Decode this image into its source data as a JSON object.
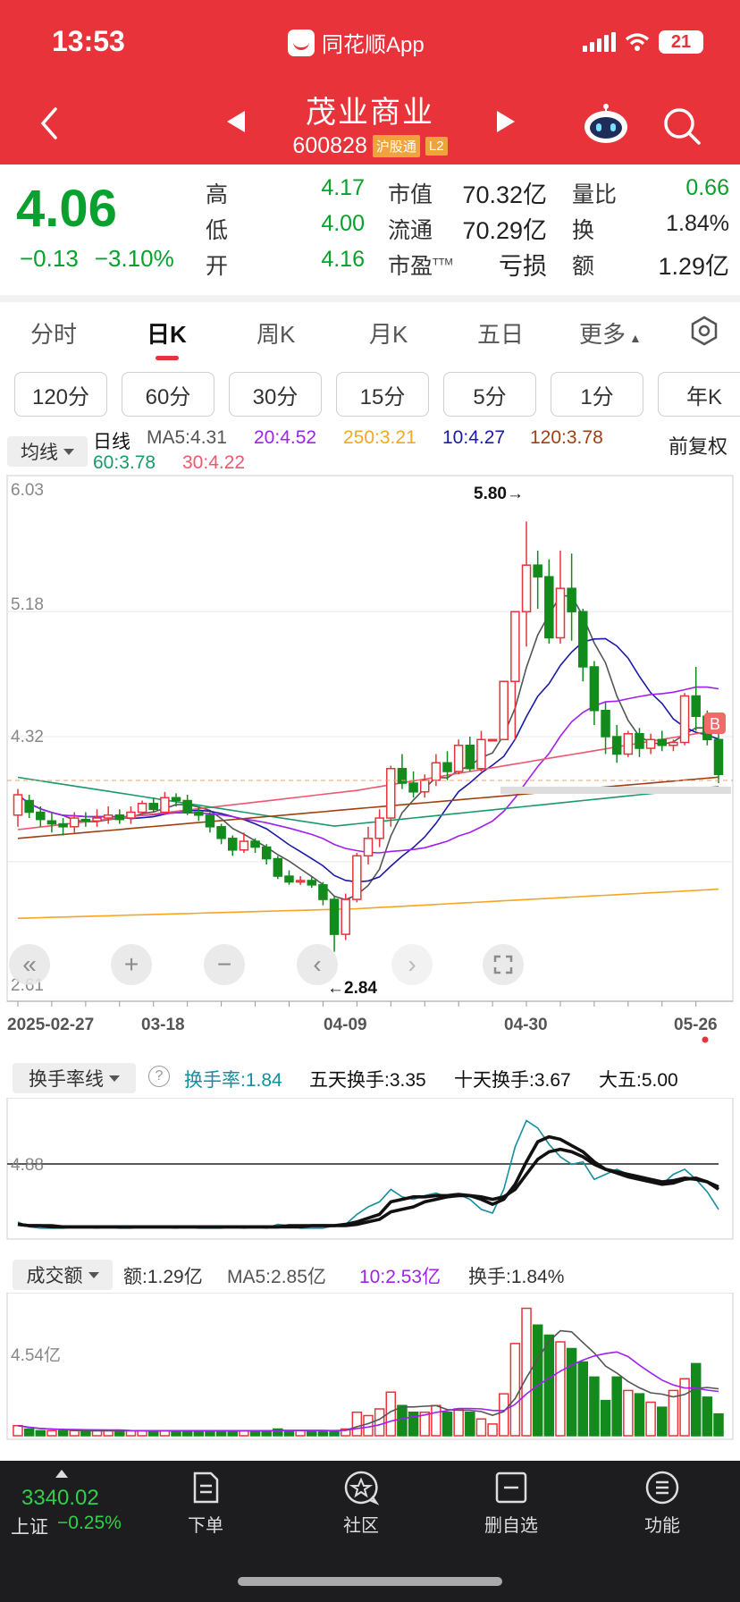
{
  "status_bar": {
    "time": "13:53",
    "app_label": "同花顺App",
    "battery": "21"
  },
  "header": {
    "stock_name": "茂业商业",
    "stock_code": "600828",
    "tag_hgt": "沪股通",
    "tag_level": "L2"
  },
  "quote": {
    "price": "4.06",
    "change": "−0.13",
    "change_pct": "−3.10%",
    "high_label": "高",
    "high": "4.17",
    "low_label": "低",
    "low": "4.00",
    "open_label": "开",
    "open": "4.16",
    "mktcap_label": "市值",
    "mktcap": "70.32亿",
    "float_label": "流通",
    "float": "70.29亿",
    "pe_label": "市盈",
    "pe_sup": "TTM",
    "pe": "亏损",
    "volratio_label": "量比",
    "volratio": "0.66",
    "turnover_label": "换",
    "turnover": "1.84%",
    "amount_label": "额",
    "amount": "1.29亿"
  },
  "tabs": [
    "分时",
    "日K",
    "周K",
    "月K",
    "五日",
    "更多"
  ],
  "periods": [
    "120分",
    "60分",
    "30分",
    "15分",
    "5分",
    "1分",
    "年K"
  ],
  "ma": {
    "selector": "均线",
    "line": "日线",
    "ma5": "MA5:4.31",
    "ma20": "20:4.52",
    "ma250": "250:3.21",
    "ma10": "10:4.27",
    "ma120": "120:3.78",
    "ma60": "60:3.78",
    "ma30": "30:4.22",
    "adjust": "前复权",
    "colors": {
      "ma5": "#555555",
      "ma10": "#1a1aa8",
      "ma20": "#a020f0",
      "ma30": "#f0566e",
      "ma60": "#1a9a6a",
      "ma120": "#a04010",
      "ma250": "#f5a623"
    }
  },
  "kline": {
    "y_labels": [
      "6.03",
      "5.18",
      "4.32",
      "2.61"
    ],
    "high_marker": "5.80→",
    "low_marker": "←2.84",
    "dates": [
      "2025-02-27",
      "03-18",
      "04-09",
      "04-30",
      "05-26"
    ],
    "b_marker": "B",
    "chart_data": {
      "type": "candlestick",
      "ylim": [
        2.61,
        6.03
      ],
      "candles": [
        [
          3.78,
          3.92,
          3.7,
          3.96
        ],
        [
          3.88,
          3.8,
          3.76,
          3.92
        ],
        [
          3.8,
          3.75,
          3.7,
          3.84
        ],
        [
          3.74,
          3.72,
          3.66,
          3.8
        ],
        [
          3.72,
          3.7,
          3.64,
          3.76
        ],
        [
          3.7,
          3.76,
          3.66,
          3.8
        ],
        [
          3.75,
          3.74,
          3.7,
          3.8
        ],
        [
          3.74,
          3.76,
          3.7,
          3.82
        ],
        [
          3.76,
          3.78,
          3.72,
          3.84
        ],
        [
          3.78,
          3.75,
          3.72,
          3.82
        ],
        [
          3.76,
          3.8,
          3.72,
          3.84
        ],
        [
          3.8,
          3.86,
          3.78,
          3.88
        ],
        [
          3.86,
          3.82,
          3.8,
          3.9
        ],
        [
          3.8,
          3.9,
          3.78,
          3.94
        ],
        [
          3.9,
          3.88,
          3.84,
          3.93
        ],
        [
          3.88,
          3.8,
          3.78,
          3.92
        ],
        [
          3.8,
          3.78,
          3.74,
          3.84
        ],
        [
          3.78,
          3.7,
          3.66,
          3.8
        ],
        [
          3.7,
          3.62,
          3.58,
          3.72
        ],
        [
          3.62,
          3.54,
          3.5,
          3.64
        ],
        [
          3.54,
          3.6,
          3.52,
          3.66
        ],
        [
          3.6,
          3.56,
          3.52,
          3.62
        ],
        [
          3.56,
          3.48,
          3.44,
          3.58
        ],
        [
          3.48,
          3.36,
          3.34,
          3.5
        ],
        [
          3.36,
          3.32,
          3.3,
          3.4
        ],
        [
          3.32,
          3.33,
          3.3,
          3.36
        ],
        [
          3.33,
          3.3,
          3.28,
          3.36
        ],
        [
          3.3,
          3.2,
          3.16,
          3.32
        ],
        [
          3.2,
          2.96,
          2.84,
          3.22
        ],
        [
          2.96,
          3.2,
          2.92,
          3.24
        ],
        [
          3.2,
          3.5,
          3.18,
          3.52
        ],
        [
          3.5,
          3.62,
          3.44,
          3.7
        ],
        [
          3.62,
          3.76,
          3.56,
          3.82
        ],
        [
          3.76,
          4.1,
          3.7,
          4.12
        ],
        [
          4.1,
          4.0,
          3.96,
          4.2
        ],
        [
          4.0,
          3.94,
          3.9,
          4.08
        ],
        [
          3.94,
          4.02,
          3.9,
          4.06
        ],
        [
          4.02,
          4.14,
          3.98,
          4.2
        ],
        [
          4.14,
          4.08,
          4.02,
          4.22
        ],
        [
          4.08,
          4.26,
          4.06,
          4.3
        ],
        [
          4.26,
          4.1,
          4.08,
          4.32
        ],
        [
          4.1,
          4.3,
          4.08,
          4.36
        ],
        [
          4.3,
          4.3,
          4.3,
          4.3
        ],
        [
          4.3,
          4.7,
          4.3,
          4.7
        ],
        [
          4.7,
          5.18,
          4.3,
          5.18
        ],
        [
          5.18,
          5.5,
          4.94,
          5.8
        ],
        [
          5.5,
          5.42,
          5.2,
          5.6
        ],
        [
          5.42,
          5.0,
          4.96,
          5.54
        ],
        [
          5.0,
          5.34,
          4.96,
          5.6
        ],
        [
          5.34,
          5.18,
          4.98,
          5.58
        ],
        [
          5.18,
          4.8,
          4.7,
          5.2
        ],
        [
          4.8,
          4.5,
          4.4,
          4.84
        ],
        [
          4.5,
          4.32,
          4.2,
          4.56
        ],
        [
          4.32,
          4.2,
          4.14,
          4.4
        ],
        [
          4.2,
          4.34,
          4.18,
          4.36
        ],
        [
          4.34,
          4.24,
          4.18,
          4.38
        ],
        [
          4.24,
          4.3,
          4.2,
          4.34
        ],
        [
          4.3,
          4.26,
          4.22,
          4.36
        ],
        [
          4.26,
          4.28,
          4.22,
          4.3
        ],
        [
          4.28,
          4.6,
          4.26,
          4.62
        ],
        [
          4.6,
          4.46,
          4.36,
          4.8
        ],
        [
          4.46,
          4.3,
          4.26,
          4.5
        ],
        [
          4.3,
          4.06,
          4.0,
          4.34
        ]
      ]
    }
  },
  "turnover_panel": {
    "selector": "换手率线",
    "help": "?",
    "rate": "换手率:1.84",
    "five": "五天换手:3.35",
    "ten": "十天换手:3.67",
    "big5": "大五:5.00",
    "y_label": "4.88",
    "chart_data": {
      "type": "line",
      "ylim": [
        0,
        10
      ],
      "series": [
        {
          "values": [
            0.8,
            0.4,
            0.3,
            0.3,
            0.3,
            0.4,
            0.4,
            0.3,
            0.4,
            0.3,
            0.3,
            0.4,
            0.4,
            0.4,
            0.3,
            0.4,
            0.3,
            0.3,
            0.3,
            0.4,
            0.3,
            0.4,
            0.3,
            0.6,
            0.5,
            0.3,
            0.3,
            0.3,
            0.5,
            0.6,
            1.4,
            2.0,
            2.4,
            3.4,
            2.8,
            2.6,
            2.9,
            3.1,
            2.8,
            3.0,
            2.6,
            1.8,
            1.5,
            3.4,
            6.8,
            8.9,
            8.3,
            7.0,
            6.0,
            5.4,
            5.6,
            4.2,
            4.6,
            5.0,
            4.6,
            4.4,
            4.1,
            3.8,
            4.6,
            5.0,
            4.2,
            3.2,
            1.8
          ]
        },
        {
          "values": [
            0.6,
            0.5,
            0.5,
            0.4,
            0.4,
            0.4,
            0.4,
            0.4,
            0.4,
            0.4,
            0.4,
            0.4,
            0.4,
            0.4,
            0.4,
            0.4,
            0.4,
            0.4,
            0.4,
            0.4,
            0.4,
            0.4,
            0.4,
            0.4,
            0.5,
            0.5,
            0.5,
            0.5,
            0.5,
            0.6,
            0.8,
            1.1,
            1.4,
            2.4,
            2.6,
            2.8,
            2.8,
            2.9,
            2.9,
            3.0,
            2.9,
            2.6,
            2.2,
            2.6,
            3.8,
            5.6,
            7.2,
            7.6,
            7.4,
            6.9,
            6.4,
            5.6,
            5.0,
            4.8,
            4.6,
            4.4,
            4.2,
            4.0,
            4.1,
            4.3,
            4.2,
            4.0,
            3.4
          ]
        },
        {
          "values": [
            0.6,
            0.5,
            0.5,
            0.5,
            0.4,
            0.4,
            0.4,
            0.4,
            0.4,
            0.4,
            0.4,
            0.4,
            0.4,
            0.4,
            0.4,
            0.4,
            0.4,
            0.4,
            0.4,
            0.4,
            0.4,
            0.4,
            0.4,
            0.4,
            0.4,
            0.4,
            0.5,
            0.5,
            0.5,
            0.5,
            0.6,
            0.8,
            1.0,
            1.6,
            1.8,
            2.0,
            2.4,
            2.6,
            2.8,
            2.9,
            2.9,
            2.8,
            2.6,
            2.8,
            3.4,
            4.6,
            5.8,
            6.4,
            6.6,
            6.4,
            6.0,
            5.4,
            5.0,
            4.7,
            4.4,
            4.2,
            4.0,
            3.8,
            3.9,
            4.2,
            4.3,
            4.0,
            3.6
          ]
        }
      ],
      "colors": [
        "#138f9e",
        "#111111",
        "#111111"
      ]
    }
  },
  "amount_panel": {
    "selector": "成交额",
    "amount": "额:1.29亿",
    "ma5": "MA5:2.85亿",
    "ma10": "10:2.53亿",
    "turnover": "换手:1.84%",
    "y_label": "4.54亿",
    "chart_data": {
      "type": "bar",
      "ylim": [
        0,
        8
      ],
      "values": [
        0.6,
        0.4,
        0.3,
        0.3,
        0.3,
        0.3,
        0.3,
        0.3,
        0.3,
        0.3,
        0.3,
        0.3,
        0.3,
        0.3,
        0.3,
        0.3,
        0.3,
        0.3,
        0.3,
        0.3,
        0.3,
        0.3,
        0.3,
        0.4,
        0.3,
        0.3,
        0.3,
        0.3,
        0.3,
        0.4,
        1.4,
        1.2,
        1.6,
        2.6,
        1.8,
        1.4,
        1.4,
        1.8,
        1.4,
        1.6,
        1.4,
        1.0,
        0.7,
        2.5,
        5.5,
        7.6,
        6.6,
        6.0,
        5.6,
        5.2,
        4.4,
        3.5,
        2.1,
        3.5,
        2.7,
        2.5,
        2.0,
        1.7,
        2.7,
        3.4,
        4.3,
        2.3,
        1.3
      ],
      "up": [
        1,
        0,
        0,
        1,
        0,
        1,
        0,
        1,
        1,
        0,
        1,
        1,
        0,
        1,
        0,
        0,
        0,
        0,
        0,
        0,
        1,
        0,
        0,
        0,
        0,
        1,
        0,
        0,
        0,
        1,
        1,
        1,
        1,
        1,
        0,
        0,
        1,
        1,
        0,
        1,
        0,
        1,
        1,
        1,
        1,
        1,
        0,
        0,
        1,
        0,
        0,
        0,
        0,
        0,
        1,
        0,
        1,
        0,
        1,
        1,
        0,
        0,
        0
      ]
    }
  },
  "footer": {
    "index_value": "3340.02",
    "index_name": "上证",
    "index_pct": "−0.25%",
    "items": [
      "下单",
      "社区",
      "删自选",
      "功能"
    ]
  }
}
